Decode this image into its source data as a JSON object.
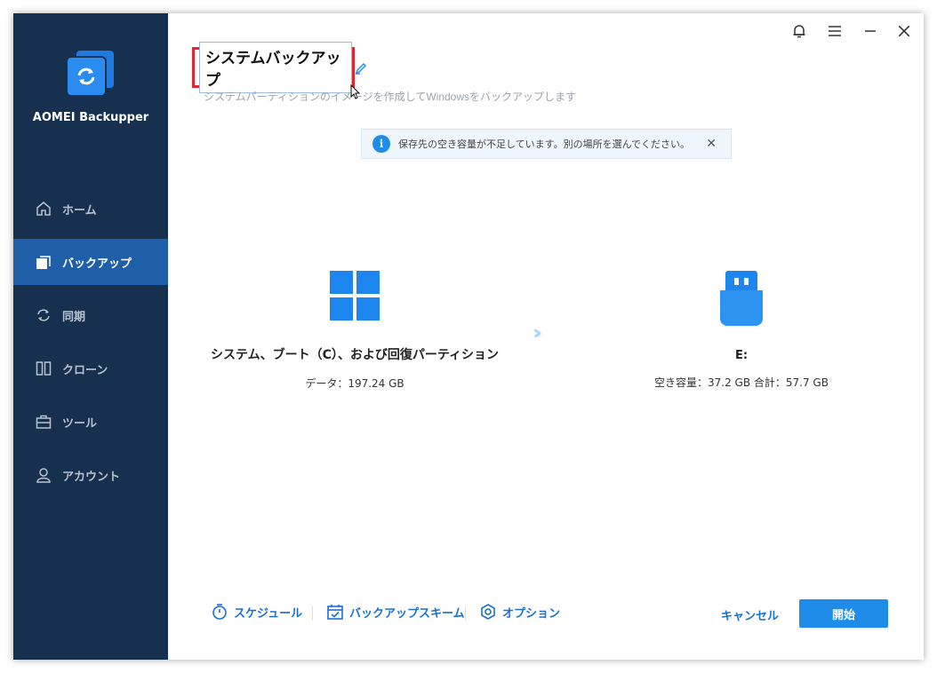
{
  "app": {
    "name": "AOMEI Backupper"
  },
  "sidebar": {
    "items": [
      {
        "label": "ホーム",
        "icon": "home-icon",
        "active": false
      },
      {
        "label": "バックアップ",
        "icon": "backup-icon",
        "active": true
      },
      {
        "label": "同期",
        "icon": "sync-icon",
        "active": false
      },
      {
        "label": "クローン",
        "icon": "clone-icon",
        "active": false
      },
      {
        "label": "ツール",
        "icon": "tools-icon",
        "active": false
      },
      {
        "label": "アカウント",
        "icon": "user-icon",
        "active": false
      }
    ]
  },
  "header": {
    "title": "システムバックアップ",
    "subtitle": "システムパーティションのイメージを作成してWindowsをバックアップします"
  },
  "notice": {
    "text": "保存先の空き容量が不足しています。別の場所を選んでください。",
    "icon": "info-icon"
  },
  "source": {
    "name": "システム、ブート（C）、および回復パーティション",
    "data": "データ：197.24 GB",
    "icon": "windows-icon"
  },
  "destination": {
    "name": "E:",
    "data": "空き容量：37.2 GB 合計：57.7 GB",
    "icon": "usb-drive-icon"
  },
  "footer": {
    "schedule_label": "スケジュール",
    "scheme_label": "バックアップスキーム",
    "options_label": "オプション",
    "cancel_label": "キャンセル",
    "start_label": "開始"
  },
  "colors": {
    "sidebar_bg": "#17304f",
    "sidebar_active": "#1e5fa8",
    "accent": "#1f8ce9",
    "highlight_border": "#e0262e"
  }
}
